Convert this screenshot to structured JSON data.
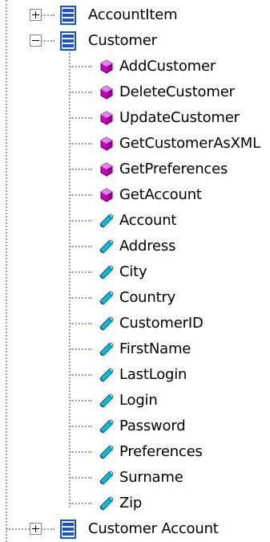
{
  "tree": {
    "nodes": [
      {
        "label": "AccountItem",
        "type": "class",
        "state": "collapsed"
      },
      {
        "label": "Customer",
        "type": "class",
        "state": "expanded",
        "children": [
          {
            "label": "AddCustomer",
            "type": "method"
          },
          {
            "label": "DeleteCustomer",
            "type": "method"
          },
          {
            "label": "UpdateCustomer",
            "type": "method"
          },
          {
            "label": "GetCustomerAsXML",
            "type": "method"
          },
          {
            "label": "GetPreferences",
            "type": "method"
          },
          {
            "label": "GetAccount",
            "type": "method"
          },
          {
            "label": "Account",
            "type": "property"
          },
          {
            "label": "Address",
            "type": "property"
          },
          {
            "label": "City",
            "type": "property"
          },
          {
            "label": "Country",
            "type": "property"
          },
          {
            "label": "CustomerID",
            "type": "property"
          },
          {
            "label": "FirstName",
            "type": "property"
          },
          {
            "label": "LastLogin",
            "type": "property"
          },
          {
            "label": "Login",
            "type": "property"
          },
          {
            "label": "Password",
            "type": "property"
          },
          {
            "label": "Preferences",
            "type": "property"
          },
          {
            "label": "Surname",
            "type": "property"
          },
          {
            "label": "Zip",
            "type": "property"
          }
        ]
      },
      {
        "label": "Customer Account",
        "type": "class",
        "state": "collapsed"
      }
    ]
  },
  "icons": {
    "class": "class-module-icon",
    "method": "method-icon",
    "property": "property-icon"
  },
  "colors": {
    "class_blue": "#1a4fd6",
    "method_magenta": "#c800c8",
    "property_cyan": "#10b8d8",
    "guide_line": "#a0a0a0"
  }
}
